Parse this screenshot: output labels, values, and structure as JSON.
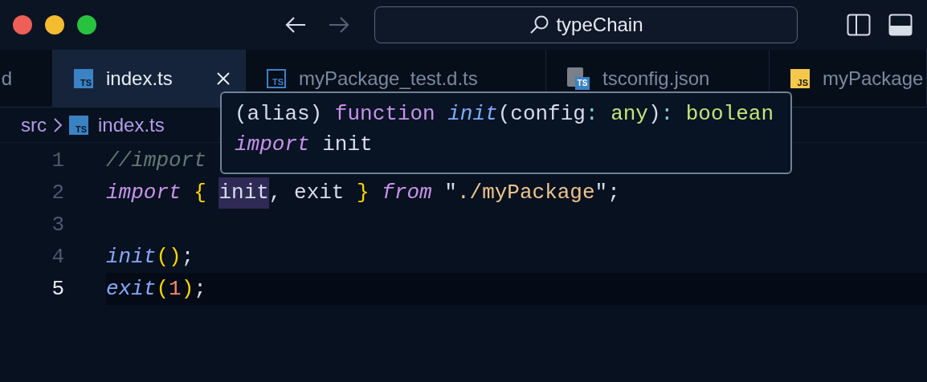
{
  "title_bar": {
    "back_disabled": false,
    "forward_disabled": true,
    "search_value": "typeChain"
  },
  "tabs": [
    {
      "label": "d",
      "selected": false,
      "close_button": false
    },
    {
      "label": "index.ts",
      "selected": true,
      "close_button": true,
      "icon": {
        "kind": "ts",
        "text": "TS"
      }
    },
    {
      "label": "myPackage_test.d.ts",
      "selected": false,
      "close_button": false,
      "icon": {
        "kind": "ts-outline",
        "text": "TS"
      }
    },
    {
      "label": "tsconfig.json",
      "selected": false,
      "close_button": false,
      "icon": {
        "kind": "tsconfig",
        "text": "TS"
      }
    },
    {
      "label": "myPackage",
      "selected": false,
      "close_button": false,
      "icon": {
        "kind": "js",
        "text": "JS"
      }
    }
  ],
  "breadcrumb": [
    {
      "label": "src"
    },
    {
      "label": "index.ts",
      "icon": {
        "kind": "ts",
        "text": "TS"
      }
    }
  ],
  "editor": {
    "lines": [
      {
        "number": "1",
        "current": false,
        "tokens": [
          {
            "text": "//import",
            "kind": "comment"
          }
        ]
      },
      {
        "number": "2",
        "current": false,
        "tokens": [
          {
            "text": "import",
            "kind": "keyword"
          },
          {
            "text": " { ",
            "kind": "brace"
          },
          {
            "text": "init",
            "kind": "plain",
            "highlighted": true
          },
          {
            "text": ", exit ",
            "kind": "plain"
          },
          {
            "text": "} ",
            "kind": "brace"
          },
          {
            "text": "from",
            "kind": "keyword"
          },
          {
            "text": " \"",
            "kind": "plain"
          },
          {
            "text": "./myPackage",
            "kind": "string"
          },
          {
            "text": "\";",
            "kind": "plain"
          }
        ]
      },
      {
        "number": "3",
        "current": false
      },
      {
        "number": "4",
        "current": false,
        "tokens": [
          {
            "text": "init",
            "kind": "function"
          },
          {
            "text": "()",
            "kind": "brace"
          },
          {
            "text": ";",
            "kind": "plain"
          }
        ]
      },
      {
        "number": "5",
        "current": true,
        "tokens": [
          {
            "text": "exit",
            "kind": "function"
          },
          {
            "text": "(",
            "kind": "brace"
          },
          {
            "text": "1",
            "kind": "number"
          },
          {
            "text": ")",
            "kind": "brace"
          },
          {
            "text": ";",
            "kind": "plain"
          }
        ]
      }
    ]
  },
  "hover": {
    "lines": [
      [
        {
          "text": "(alias) ",
          "kind": "plain"
        },
        {
          "text": "function ",
          "kind": "storage"
        },
        {
          "text": "init",
          "kind": "function"
        },
        {
          "text": "(config",
          "kind": "plain"
        },
        {
          "text": ": ",
          "kind": "colon"
        },
        {
          "text": "any",
          "kind": "type"
        },
        {
          "text": ")",
          "kind": "plain"
        },
        {
          "text": ": ",
          "kind": "colon"
        },
        {
          "text": "boolean",
          "kind": "type"
        }
      ],
      [
        {
          "text": "import",
          "kind": "keyword"
        },
        {
          "text": " init",
          "kind": "plain"
        }
      ]
    ]
  }
}
